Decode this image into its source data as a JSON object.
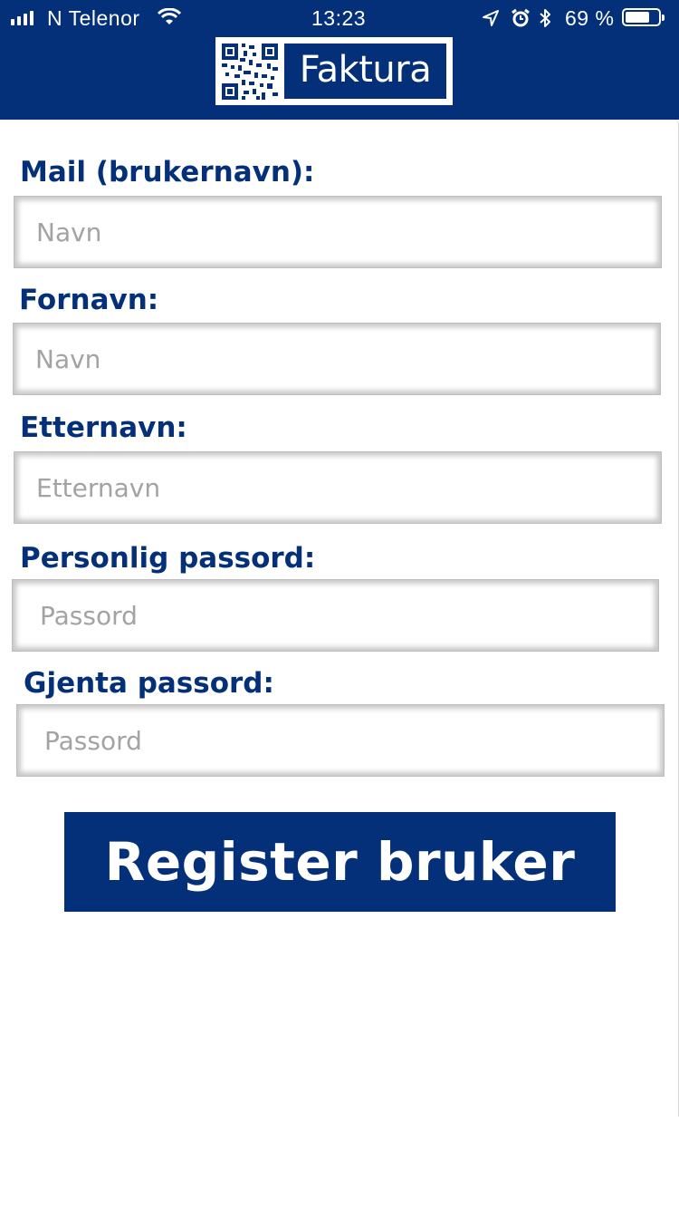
{
  "status_bar": {
    "carrier": "N Telenor",
    "time": "13:23",
    "battery_percent": "69 %",
    "battery_level": 0.69
  },
  "header": {
    "logo_text": "Faktura",
    "color": "#033079"
  },
  "form": {
    "fields": [
      {
        "label": "Mail (brukernavn):",
        "placeholder": "Navn",
        "value": ""
      },
      {
        "label": "Fornavn:",
        "placeholder": "Navn",
        "value": ""
      },
      {
        "label": "Etternavn:",
        "placeholder": "Etternavn",
        "value": ""
      },
      {
        "label": "Personlig passord:",
        "placeholder": "Passord",
        "value": ""
      },
      {
        "label": "Gjenta passord:",
        "placeholder": "Passord",
        "value": ""
      }
    ],
    "submit_label": "Register bruker"
  },
  "icons": [
    "signal-icon",
    "wifi-icon",
    "location-arrow-icon",
    "alarm-icon",
    "bluetooth-icon",
    "battery-icon",
    "qr-code-icon"
  ]
}
